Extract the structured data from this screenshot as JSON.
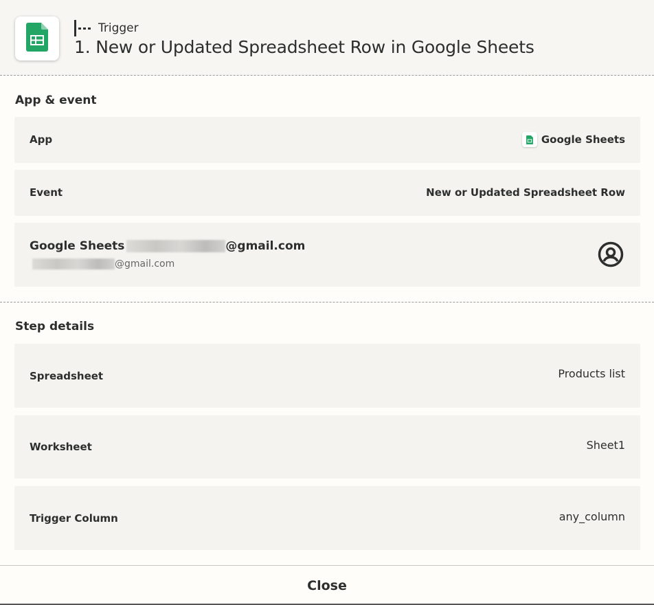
{
  "header": {
    "app_icon": "google-sheets-icon",
    "trigger_icon": "trigger-icon",
    "trigger_label": "Trigger",
    "step_title": "1. New or Updated Spreadsheet Row in Google Sheets"
  },
  "app_event": {
    "section_title": "App & event",
    "app_label": "App",
    "app_value": "Google Sheets",
    "event_label": "Event",
    "event_value": "New or Updated Spreadsheet Row",
    "account": {
      "name_prefix": "Google Sheets",
      "name_suffix": "@gmail.com",
      "email_suffix": "@gmail.com",
      "icon": "user-circle-icon"
    }
  },
  "step_details": {
    "section_title": "Step details",
    "fields": [
      {
        "label": "Spreadsheet",
        "value": "Products list"
      },
      {
        "label": "Worksheet",
        "value": "Sheet1"
      },
      {
        "label": "Trigger Column",
        "value": "any_column"
      }
    ]
  },
  "footer": {
    "close_label": "Close"
  },
  "colors": {
    "sheets_green": "#23a566",
    "card_bg": "#f4f3ef",
    "page_bg": "#fffdf9"
  }
}
